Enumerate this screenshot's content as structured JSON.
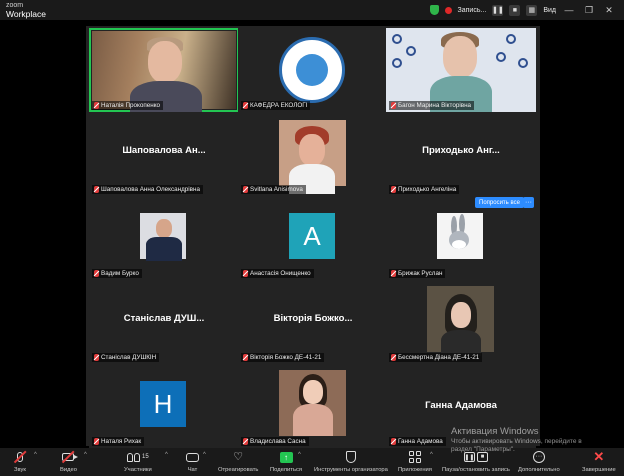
{
  "titlebar": {
    "brand_line1": "zoom",
    "brand_line2": "Workplace",
    "recording_label": "Запись...",
    "pause_glyph": "❚❚",
    "stop_glyph": "■",
    "view_label": "Вид",
    "window_controls": [
      "—",
      "❐",
      "✕"
    ]
  },
  "tiles": [
    {
      "id": "t1",
      "name": "Наталія Прокопенко",
      "display": "video",
      "active": true
    },
    {
      "id": "t2",
      "name": "КАФЕДРА ЕКОЛОГІ",
      "display": "logo"
    },
    {
      "id": "t3",
      "name": "Багон Марина Вікторівна",
      "display": "video"
    },
    {
      "id": "t4",
      "name": "Шаповалова Анна Олександрівна",
      "display": "text",
      "big_name": "Шаповалова Ан..."
    },
    {
      "id": "t5",
      "name": "Svitlana Anisimova",
      "display": "photo"
    },
    {
      "id": "t6",
      "name": "Приходько Ангеліна",
      "display": "text",
      "big_name": "Приходько Анг..."
    },
    {
      "id": "t7",
      "name": "Вадим Бурко",
      "display": "photo"
    },
    {
      "id": "t8",
      "name": "Анастасія Онищенко",
      "display": "letter",
      "letter": "A",
      "color": "#1fa3b8"
    },
    {
      "id": "t9",
      "name": "Брижак Руслан",
      "display": "photo"
    },
    {
      "id": "t10",
      "name": "Станіслав ДУШКІН",
      "display": "text",
      "big_name": "Станіслав ДУШ..."
    },
    {
      "id": "t11",
      "name": "Вікторія Божко ДЕ-41-21",
      "display": "text",
      "big_name": "Вікторія Божко..."
    },
    {
      "id": "t12",
      "name": "Бессмертна Діана ДЕ-41-21",
      "display": "photo"
    },
    {
      "id": "t13",
      "name": "Наталя Рихак",
      "display": "letter",
      "letter": "H",
      "color": "#0d6fb8"
    },
    {
      "id": "t14",
      "name": "Владислава Сасна",
      "display": "photo"
    },
    {
      "id": "t15",
      "name": "Ганна Адамова",
      "display": "text",
      "big_name": "Ганна Адамова"
    }
  ],
  "ask_all_button": "Попросить все",
  "more_button": "···",
  "watermark": {
    "line1": "Активация Windows",
    "line2": "Чтобы активировать Windows, перейдите в",
    "line3": "раздел \"Параметры\"."
  },
  "toolbar": {
    "audio": "Звук",
    "video": "Видео",
    "participants": "Участники",
    "participants_count": "15",
    "chat": "Чат",
    "reactions": "Отреагировать",
    "share": "Поделиться",
    "organizer_tools": "Инструменты организатора",
    "apps": "Приложения",
    "pause_rec": "Пауза/остановить запись",
    "more": "Дополнительно",
    "end": "Завершение"
  },
  "colors": {
    "accent_green": "#23c552",
    "accent_blue": "#2d8cff",
    "muted_red": "#e03b3b"
  }
}
